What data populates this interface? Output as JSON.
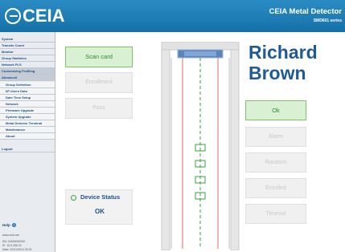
{
  "header": {
    "logo": "CEIA",
    "title": "CEIA Metal Detector",
    "subtitle": "SMD601 series"
  },
  "sidebar": {
    "items": [
      {
        "label": "System",
        "sub": false,
        "hl": false
      },
      {
        "label": "Transits Count",
        "sub": false,
        "hl": false
      },
      {
        "label": "Monitor",
        "sub": false,
        "hl": false
      },
      {
        "label": "Group Statistics",
        "sub": false,
        "hl": false
      },
      {
        "label": "Network PLS",
        "sub": false,
        "hl": false
      },
      {
        "label": "Customizing Profiling",
        "sub": false,
        "hl": true
      },
      {
        "label": "Advanced",
        "sub": false,
        "hl": true
      },
      {
        "label": "Group Definition",
        "sub": true,
        "hl": false
      },
      {
        "label": "I/P Users Data",
        "sub": true,
        "hl": false
      },
      {
        "label": "Date Time Setup",
        "sub": true,
        "hl": false
      },
      {
        "label": "Network",
        "sub": true,
        "hl": false
      },
      {
        "label": "Firmware Upgrade",
        "sub": true,
        "hl": false
      },
      {
        "label": "System Upgrade",
        "sub": true,
        "hl": false
      },
      {
        "label": "Metal Detector Terminal",
        "sub": true,
        "hl": false
      },
      {
        "label": "Maintenance",
        "sub": true,
        "hl": false
      },
      {
        "label": "About",
        "sub": true,
        "hl": false
      },
      {
        "label": "Logout",
        "sub": false,
        "hl": false
      }
    ],
    "help_label": "Help",
    "help_icon": "?",
    "foot": [
      "www.ceia.net",
      "SN: 00000000000",
      "IP: 10.0.255.22",
      "Date: 01/01/2014 09:31"
    ]
  },
  "main": {
    "scan_card": "Scan card",
    "enrollment": "Enrollment",
    "pass": "Pass",
    "device_status_label": "Device Status",
    "device_status_value": "OK",
    "person_first": "Richard",
    "person_last": "Brown",
    "actions": [
      "Ok",
      "Alarm",
      "Random",
      "Enrolled",
      "Timeout"
    ]
  },
  "colors": {
    "accent": "#1f5a96",
    "header": "#1670a8",
    "green": "#3aa13a",
    "red_line": "#e05a5a"
  }
}
